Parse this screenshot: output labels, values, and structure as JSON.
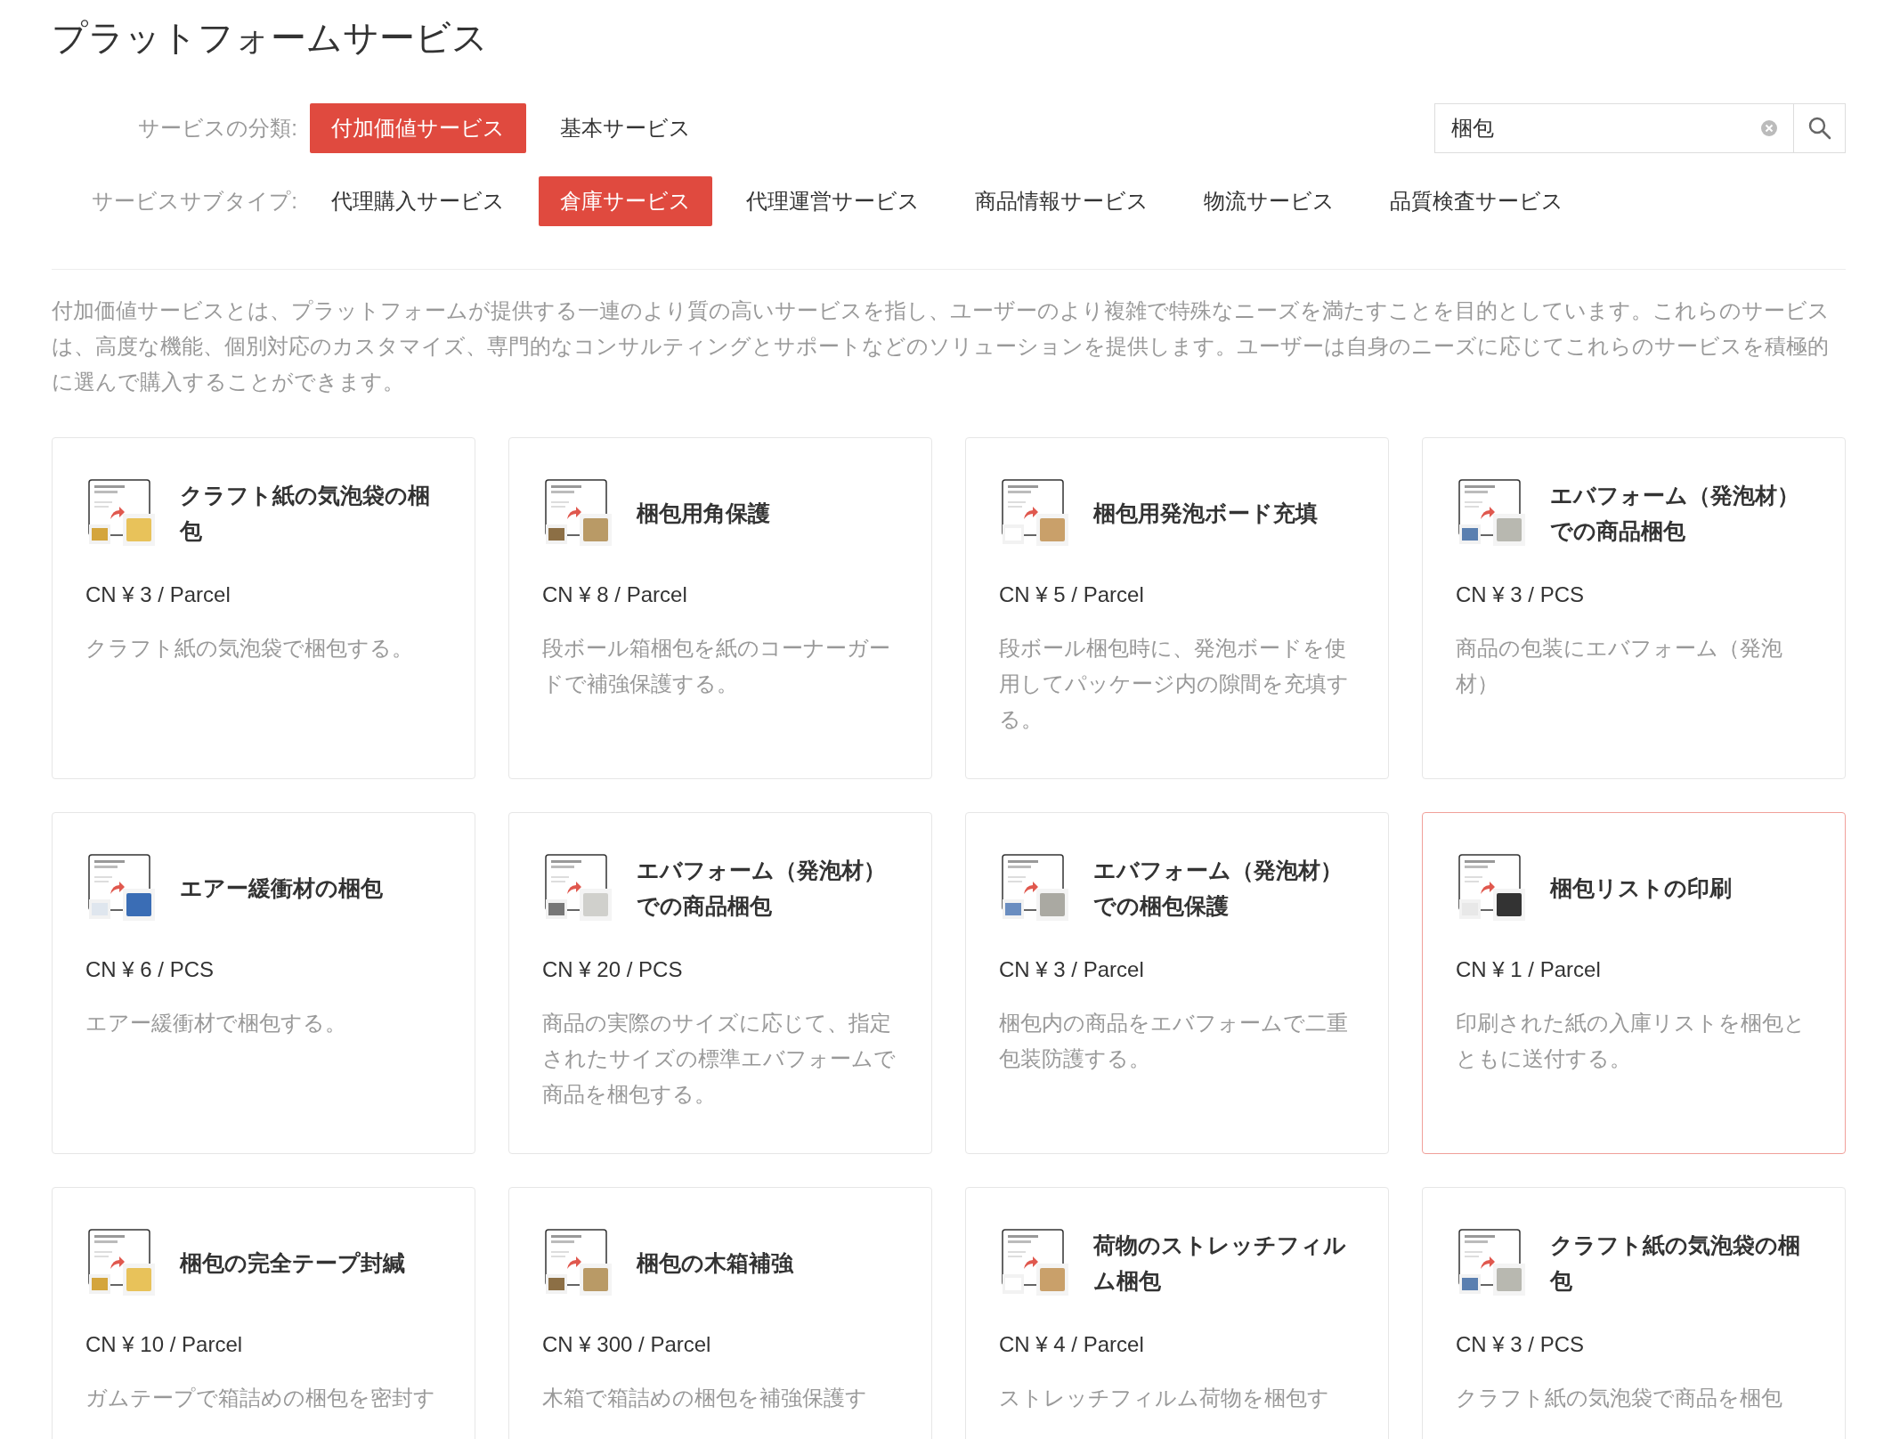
{
  "page_title": "プラットフォームサービス",
  "filters": [
    {
      "label": "サービスの分類:",
      "options": [
        {
          "label": "付加価値サービス",
          "selected": true
        },
        {
          "label": "基本サービス",
          "selected": false
        }
      ]
    },
    {
      "label": "サービスサブタイプ:",
      "options": [
        {
          "label": "代理購入サービス",
          "selected": false
        },
        {
          "label": "倉庫サービス",
          "selected": true
        },
        {
          "label": "代理運営サービス",
          "selected": false
        },
        {
          "label": "商品情報サービス",
          "selected": false
        },
        {
          "label": "物流サービス",
          "selected": false
        },
        {
          "label": "品質検査サービス",
          "selected": false
        }
      ]
    }
  ],
  "search": {
    "value": "梱包"
  },
  "intro": "付加価値サービスとは、プラットフォームが提供する一連のより質の高いサービスを指し、ユーザーのより複雑で特殊なニーズを満たすことを目的としています。これらのサービスは、高度な機能、個別対応のカスタマイズ、専門的なコンサルティングとサポートなどのソリューションを提供します。ユーザーは自身のニーズに応じてこれらのサービスを積極的に選んで購入することができます。",
  "services": [
    {
      "title": "クラフト紙の気泡袋の梱包",
      "price": "CN ¥ 3 / Parcel",
      "description": "クラフト紙の気泡袋で梱包する。",
      "selected": false
    },
    {
      "title": "梱包用角保護",
      "price": "CN ¥ 8 / Parcel",
      "description": "段ボール箱梱包を紙のコーナーガードで補強保護する。",
      "selected": false
    },
    {
      "title": "梱包用発泡ボード充填",
      "price": "CN ¥ 5 / Parcel",
      "description": "段ボール梱包時に、発泡ボードを使用してパッケージ内の隙間を充填する。",
      "selected": false
    },
    {
      "title": "エバフォーム（発泡材）での商品梱包",
      "price": "CN ¥ 3 / PCS",
      "description": "商品の包装にエバフォーム（発泡材）",
      "selected": false
    },
    {
      "title": "エアー緩衝材の梱包",
      "price": "CN ¥ 6 / PCS",
      "description": "エアー緩衝材で梱包する。",
      "selected": false
    },
    {
      "title": "エバフォーム（発泡材）での商品梱包",
      "price": "CN ¥ 20 / PCS",
      "description": "商品の実際のサイズに応じて、指定されたサイズの標準エバフォームで商品を梱包する。",
      "selected": false
    },
    {
      "title": "エバフォーム（発泡材）での梱包保護",
      "price": "CN ¥ 3 / Parcel",
      "description": "梱包内の商品をエバフォームで二重包装防護する。",
      "selected": false
    },
    {
      "title": "梱包リストの印刷",
      "price": "CN ¥ 1 / Parcel",
      "description": "印刷された紙の入庫リストを梱包とともに送付する。",
      "selected": true
    },
    {
      "title": "梱包の完全テープ封緘",
      "price": "CN ¥ 10 / Parcel",
      "description": "ガムテープで箱詰めの梱包を密封す",
      "selected": false
    },
    {
      "title": "梱包の木箱補強",
      "price": "CN ¥ 300 / Parcel",
      "description": "木箱で箱詰めの梱包を補強保護す",
      "selected": false
    },
    {
      "title": "荷物のストレッチフィルム梱包",
      "price": "CN ¥ 4 / Parcel",
      "description": "ストレッチフィルム荷物を梱包す",
      "selected": false
    },
    {
      "title": "クラフト紙の気泡袋の梱包",
      "price": "CN ¥ 3 / PCS",
      "description": "クラフト紙の気泡袋で商品を梱包",
      "selected": false
    }
  ]
}
